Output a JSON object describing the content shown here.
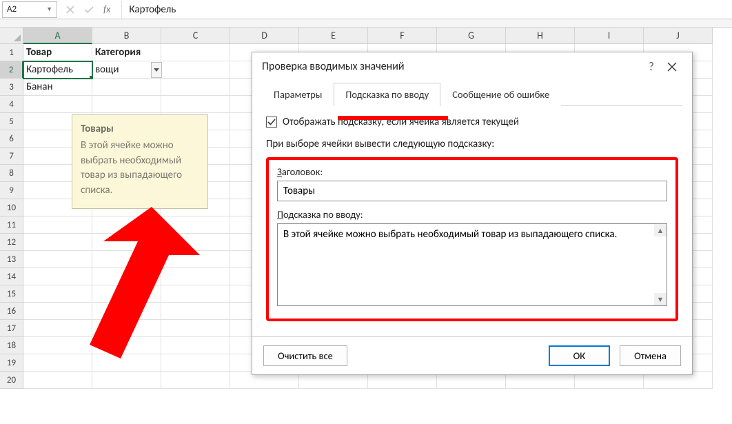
{
  "formula_bar": {
    "name_box": "A2",
    "fx_label": "fx",
    "formula_value": "Картофель"
  },
  "grid": {
    "columns": [
      "A",
      "B",
      "C",
      "D",
      "E",
      "F",
      "G",
      "H",
      "I",
      "J"
    ],
    "row_numbers": [
      1,
      2,
      3,
      4,
      5,
      6,
      7,
      8,
      9,
      10,
      11,
      12,
      13,
      14,
      15,
      16,
      17,
      18,
      19,
      20
    ],
    "selected_col_index": 0,
    "selected_row_index": 1,
    "data": {
      "A1": "Товар",
      "B1": "Категория",
      "A2": "Картофель",
      "B2": "вощи",
      "A3": "Банан"
    }
  },
  "tooltip": {
    "title": "Товары",
    "body": "В этой ячейке можно выбрать необходимый товар из выпадающего списка."
  },
  "dialog": {
    "title": "Проверка вводимых значений",
    "help": "?",
    "tabs": {
      "params": "Параметры",
      "input_msg": "Подсказка по вводу",
      "error_msg": "Сообщение об ошибке"
    },
    "show_checkbox_label": "Отображать подсказку, если ячейка является текущей",
    "show_checkbox_checked": true,
    "section_label": "При выборе ячейки вывести следующую подсказку:",
    "title_field": {
      "label_pre": "З",
      "label_rest": "аголовок:",
      "value": "Товары"
    },
    "msg_field": {
      "label_pre": "П",
      "label_rest": "одсказка по вводу:",
      "value": "В этой ячейке можно выбрать необходимый товар из выпадающего списка."
    },
    "buttons": {
      "clear": "Очистить все",
      "ok": "ОК",
      "cancel": "Отмена"
    }
  }
}
